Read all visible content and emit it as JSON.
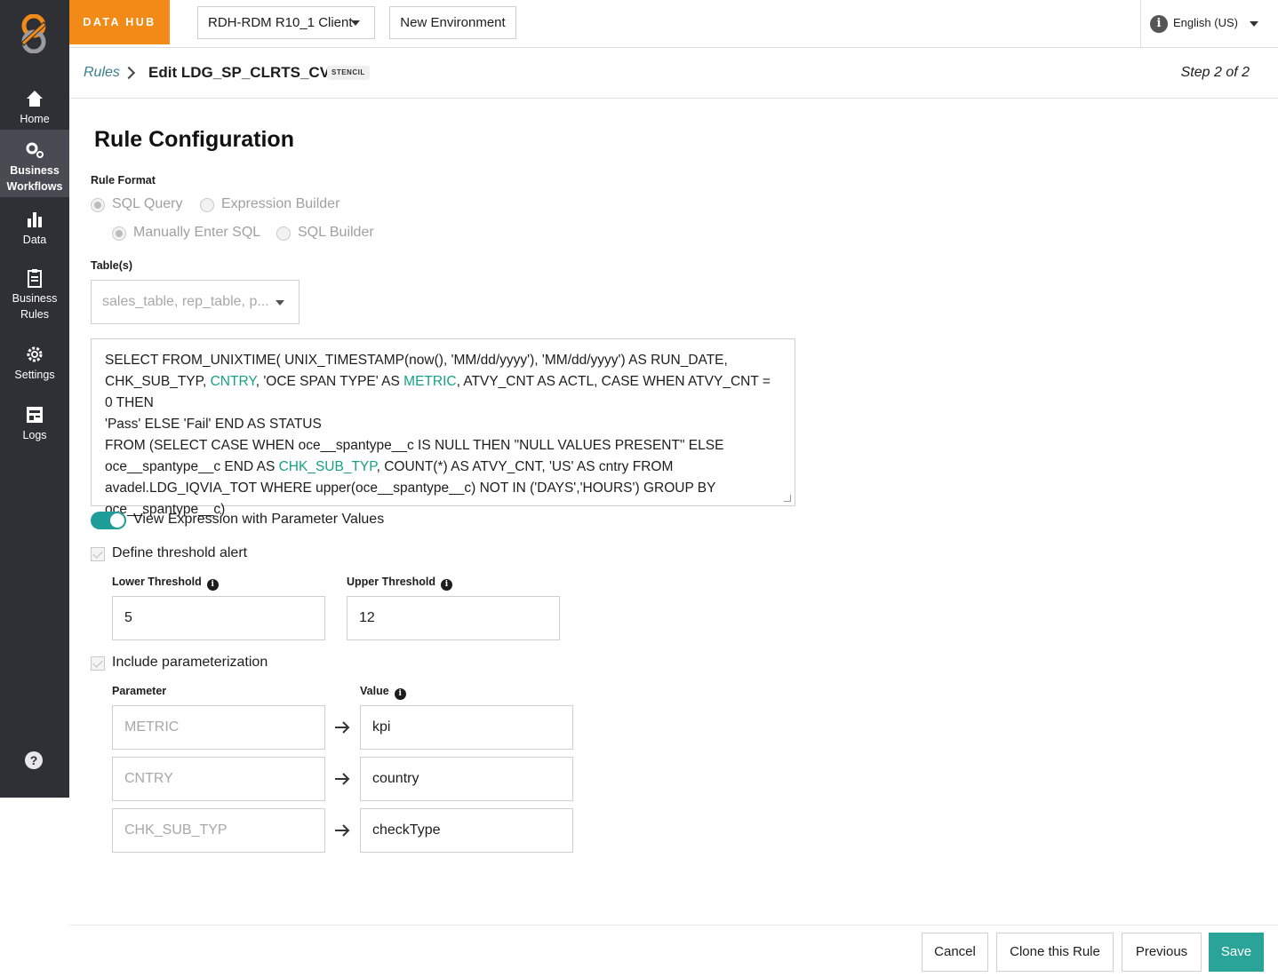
{
  "sidebar": {
    "items": [
      {
        "label": "Home",
        "icon": "home-icon"
      },
      {
        "label": "Business Workflows",
        "icon": "gears-icon"
      },
      {
        "label": "Data",
        "icon": "bar-chart-icon"
      },
      {
        "label": "Business Rules",
        "icon": "clipboard-icon"
      },
      {
        "label": "Settings",
        "icon": "gear-icon"
      },
      {
        "label": "Logs",
        "icon": "logs-icon"
      }
    ],
    "help_symbol": "?"
  },
  "topbar": {
    "brand": "DATA HUB",
    "client": "RDH-RDM R10_1 Client",
    "env_button": "New Environment",
    "language": "English (US)"
  },
  "breadcrumb": {
    "link": "Rules",
    "title": "Edit LDG_SP_CLRTS_CVRG",
    "badge": "STENCIL",
    "step": "Step 2 of 2"
  },
  "form": {
    "heading": "Rule Configuration",
    "rule_format_label": "Rule Format",
    "format_options": [
      "SQL Query",
      "Expression Builder"
    ],
    "sql_options": [
      "Manually Enter SQL",
      "SQL Builder"
    ],
    "tables_label": "Table(s)",
    "tables_value": "sales_table, rep_table, p...",
    "sql": {
      "l1": "SELECT FROM_UNIXTIME( UNIX_TIMESTAMP(now(), 'MM/dd/yyyy'), 'MM/dd/yyyy') AS RUN_DATE,",
      "l2a": "CHK_SUB_TYP, ",
      "l2b": "CNTRY",
      "l2c": ", 'OCE SPAN TYPE' AS ",
      "l2d": "METRIC",
      "l2e": ", ATVY_CNT AS ACTL, CASE WHEN ATVY_CNT = 0 THEN",
      "l3": "'Pass' ELSE 'Fail' END AS STATUS",
      "l4": "FROM (SELECT CASE WHEN oce__spantype__c IS NULL THEN \"NULL VALUES PRESENT\" ELSE",
      "l5a": "oce__spantype__c END AS ",
      "l5b": "CHK_SUB_TYP",
      "l5c": ", COUNT(*) AS ATVY_CNT, 'US' AS cntry FROM",
      "l6": "avadel.LDG_IQVIA_TOT WHERE upper(oce__spantype__c) NOT IN ('DAYS','HOURS') GROUP BY",
      "l7": "oce__spantype__c)"
    },
    "toggle_label": "View Expression with Parameter Values",
    "threshold_label": "Define threshold alert",
    "lower_label": "Lower Threshold",
    "lower_value": "5",
    "upper_label": "Upper Threshold",
    "upper_value": "12",
    "param_label": "Include parameterization",
    "param_col": "Parameter",
    "value_col": "Value",
    "params": [
      {
        "name": "METRIC",
        "value": "kpi"
      },
      {
        "name": "CNTRY",
        "value": "country"
      },
      {
        "name": "CHK_SUB_TYP",
        "value": "checkType"
      }
    ],
    "info_symbol": "i"
  },
  "footer": {
    "cancel": "Cancel",
    "clone": "Clone this Rule",
    "previous": "Previous",
    "save": "Save"
  },
  "colors": {
    "brand": "#f28a18",
    "accent": "#2aa399",
    "sidebar": "#2f2f36",
    "link": "#3a7d8c"
  }
}
